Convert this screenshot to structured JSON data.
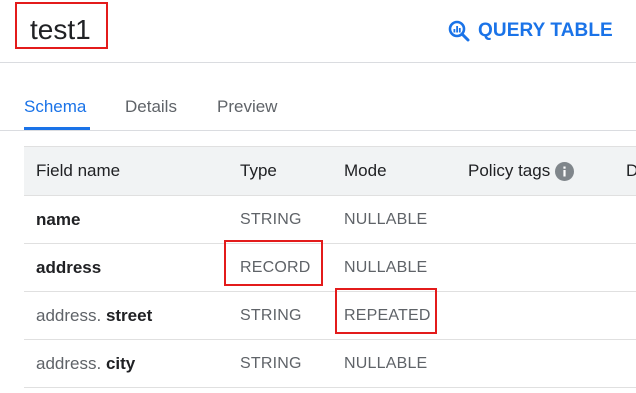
{
  "header": {
    "title": "test1",
    "query_button": {
      "label": "QUERY TABLE",
      "icon": "query-search-icon",
      "color": "#1a73e8"
    }
  },
  "tabs": [
    {
      "label": "Schema",
      "active": true
    },
    {
      "label": "Details",
      "active": false
    },
    {
      "label": "Preview",
      "active": false
    }
  ],
  "table": {
    "columns": {
      "field_name": "Field name",
      "type": "Type",
      "mode": "Mode",
      "policy_tags": "Policy tags",
      "description": "D"
    },
    "rows": [
      {
        "prefix": "",
        "name": "name",
        "type": "STRING",
        "mode": "NULLABLE"
      },
      {
        "prefix": "",
        "name": "address",
        "type": "RECORD",
        "mode": "NULLABLE"
      },
      {
        "prefix": "address.",
        "name": "street",
        "type": "STRING",
        "mode": "REPEATED"
      },
      {
        "prefix": "address.",
        "name": "city",
        "type": "STRING",
        "mode": "NULLABLE"
      }
    ]
  },
  "colors": {
    "accent": "#1a73e8",
    "highlight": "#e31b1b",
    "header_bg": "#f1f3f4"
  }
}
